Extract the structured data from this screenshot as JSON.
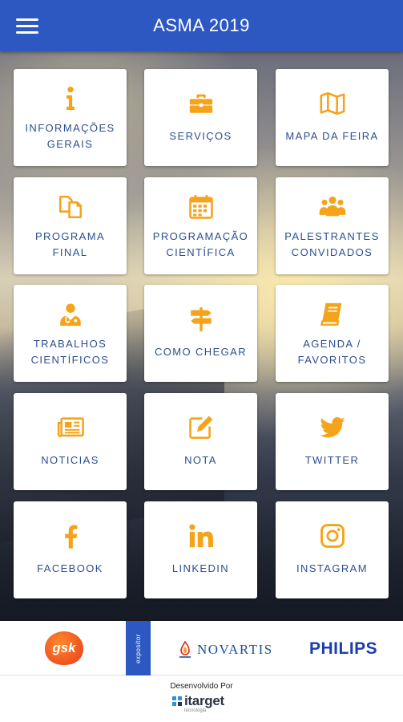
{
  "appbar": {
    "title": "ASMA 2019",
    "menu_icon": "hamburger-icon"
  },
  "accent_color": "#f5a31a",
  "label_color": "#2c4f8f",
  "header_color": "#2d58c2",
  "tiles": [
    {
      "label": "INFORMAÇÕES GERAIS",
      "icon": "info-icon"
    },
    {
      "label": "SERVIÇOS",
      "icon": "briefcase-icon"
    },
    {
      "label": "MAPA DA FEIRA",
      "icon": "map-icon"
    },
    {
      "label": "PROGRAMA FINAL",
      "icon": "copy-icon"
    },
    {
      "label": "PROGRAMAÇÃO CIENTÍFICA",
      "icon": "calendar-icon"
    },
    {
      "label": "PALESTRANTES CONVIDADOS",
      "icon": "users-icon"
    },
    {
      "label": "TRABALHOS CIENTÍFICOS",
      "icon": "doctor-icon"
    },
    {
      "label": "COMO CHEGAR",
      "icon": "signpost-icon"
    },
    {
      "label": "AGENDA / FAVORITOS",
      "icon": "book-icon"
    },
    {
      "label": "NOTICIAS",
      "icon": "newspaper-icon"
    },
    {
      "label": "NOTA",
      "icon": "edit-icon"
    },
    {
      "label": "TWITTER",
      "icon": "twitter-icon"
    },
    {
      "label": "FACEBOOK",
      "icon": "facebook-icon"
    },
    {
      "label": "LINKEDIN",
      "icon": "linkedin-icon"
    },
    {
      "label": "INSTAGRAM",
      "icon": "instagram-icon"
    }
  ],
  "sponsors": {
    "gsk": "gsk",
    "expositor": "expositor",
    "novartis": "NOVARTIS",
    "philips": "PHILIPS"
  },
  "footer": {
    "developed_by": "Desenvolvido Por",
    "brand": "itarget",
    "brand_sub": "tecnologia"
  }
}
